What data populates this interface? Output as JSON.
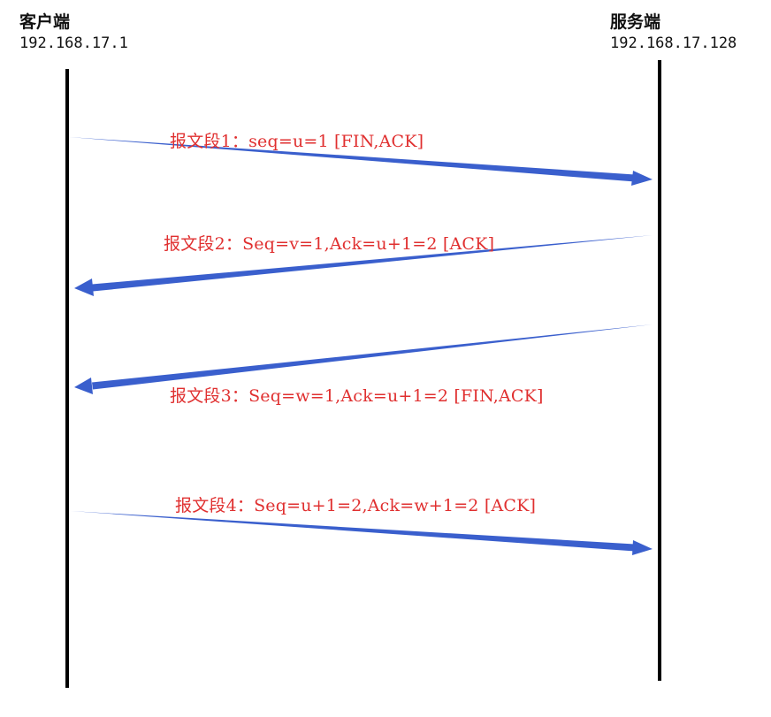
{
  "client": {
    "name": "客户端",
    "ip": "192.168.17.1"
  },
  "server": {
    "name": "服务端",
    "ip": "192.168.17.128"
  },
  "segments": [
    {
      "label": "报文段1：seq=u=1 [FIN,ACK]",
      "direction": "client-to-server"
    },
    {
      "label": "报文段2：Seq=v=1,Ack=u+1=2 [ACK]",
      "direction": "server-to-client"
    },
    {
      "label": "报文段3：Seq=w=1,Ack=u+1=2 [FIN,ACK]",
      "direction": "server-to-client"
    },
    {
      "label": "报文段4：Seq=u+1=2,Ack=w+1=2 [ACK]",
      "direction": "client-to-server"
    }
  ],
  "colors": {
    "arrow": "#3a5fcd",
    "label": "#e03030",
    "lifeline": "#000000"
  }
}
